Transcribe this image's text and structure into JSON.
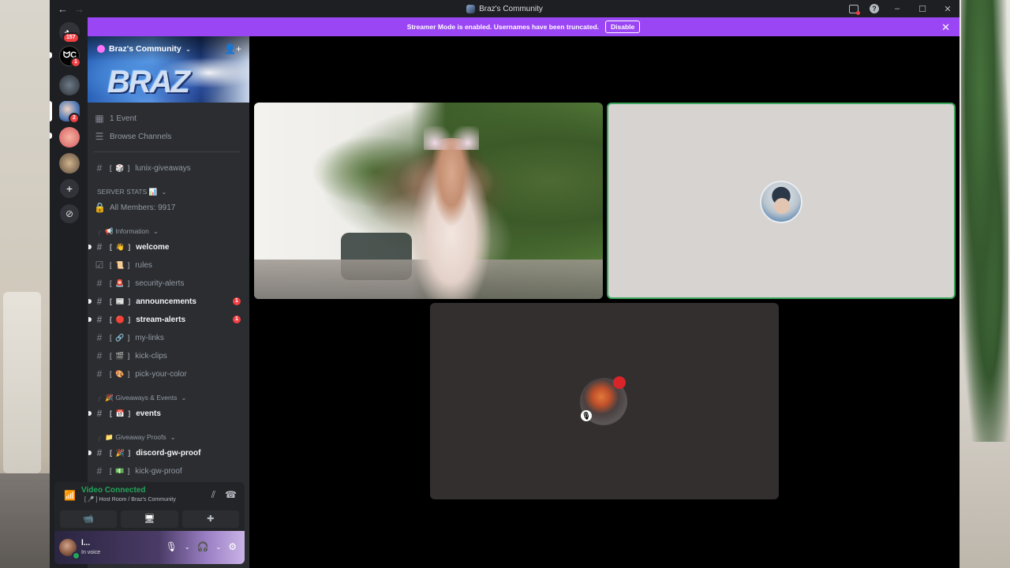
{
  "window": {
    "title": "Braz's Community",
    "back_icon": "←",
    "forward_icon": "→",
    "minimize": "–",
    "maximize": "☐",
    "close": "✕",
    "help_glyph": "?"
  },
  "rail": {
    "dm_badge": "157",
    "server2_badge": "1",
    "server4_badge": "2",
    "add_glyph": "+",
    "explore_glyph": "⊘"
  },
  "banner": {
    "text": "Streamer Mode is enabled. Usernames have been truncated.",
    "button": "Disable",
    "close": "✕",
    "color": "#9b46f5"
  },
  "server": {
    "name": "Braz's Community",
    "banner_text": "BRAZ",
    "chevron": "⌄",
    "invite_icon": "👤+"
  },
  "sidebar": {
    "event": "1 Event",
    "browse": "Browse Channels",
    "giveaways_channel": {
      "emoji": "[ 🎲 ]",
      "name": "lunix-giveaways"
    },
    "stats_category": "SERVER STATS 📊",
    "members": "All Members: 9917",
    "categories": {
      "information": "📢 Information",
      "giveaways": "🎉 Giveaways & Events",
      "proofs": "📁 Giveaway Proofs"
    },
    "channels": [
      {
        "emoji": "[ 👋 ]",
        "name": "welcome"
      },
      {
        "emoji": "[ 📜 ]",
        "name": "rules"
      },
      {
        "emoji": "[ 🚨 ]",
        "name": "security-alerts"
      },
      {
        "emoji": "[ 📰 ]",
        "name": "announcements",
        "mentions": "1"
      },
      {
        "emoji": "[ 🔴 ]",
        "name": "stream-alerts",
        "mentions": "1"
      },
      {
        "emoji": "[ 🔗 ]",
        "name": "my-links"
      },
      {
        "emoji": "[ 🎬 ]",
        "name": "kick-clips"
      },
      {
        "emoji": "[ 🎨 ]",
        "name": "pick-your-color"
      },
      {
        "emoji": "[ 📅 ]",
        "name": "events"
      },
      {
        "emoji": "[ 🎉 ]",
        "name": "discord-gw-proof"
      },
      {
        "emoji": "[ 💵 ]",
        "name": "kick-gw-proof"
      }
    ]
  },
  "voice": {
    "status": "Video Connected",
    "location": "[ 🎤 ] Host Room / Braz's Community",
    "camera_icon": "📹",
    "share_icon": "🖥",
    "activity_icon": "✚"
  },
  "user": {
    "name": "l...",
    "status": "In voice",
    "settings_icon": "⚙"
  }
}
